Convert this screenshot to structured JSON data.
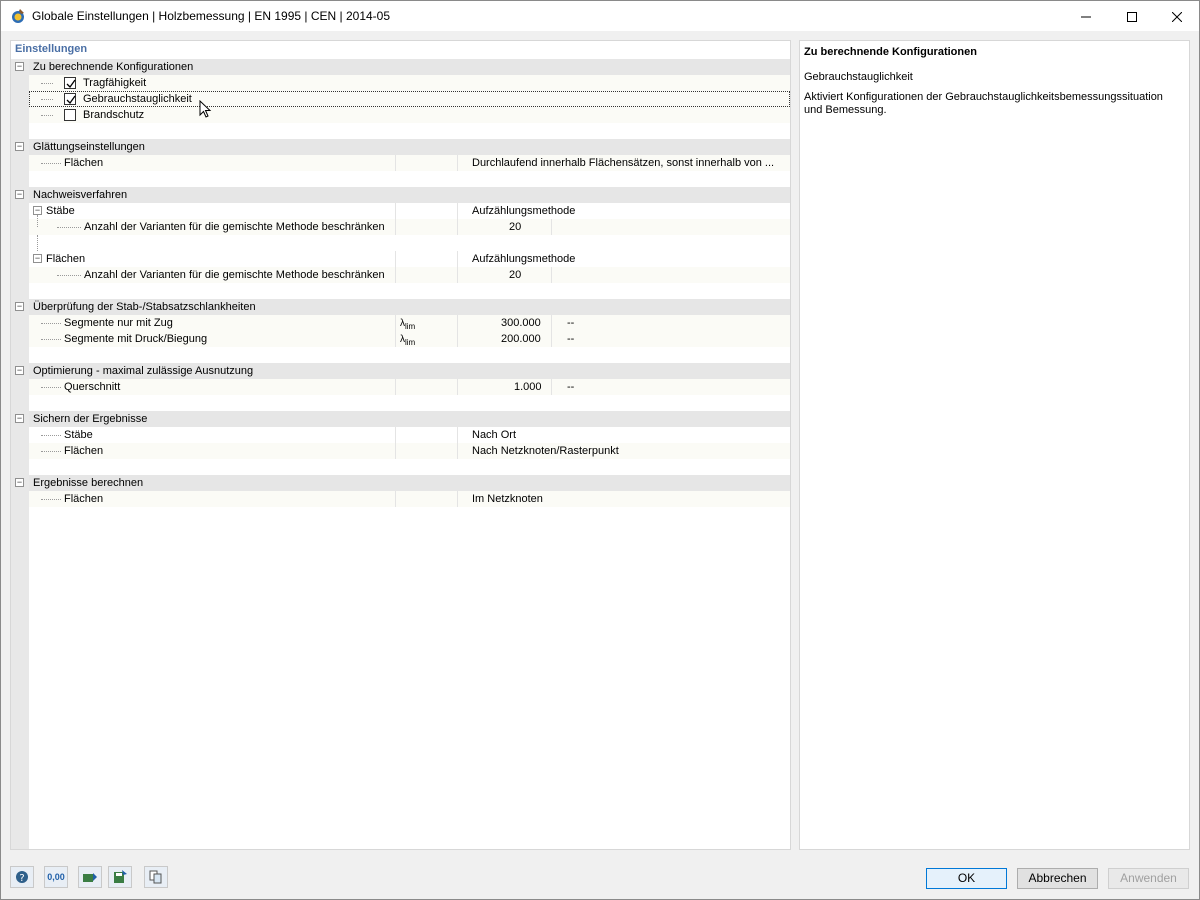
{
  "window": {
    "title": "Globale Einstellungen | Holzbemessung | EN 1995 | CEN | 2014-05"
  },
  "left_panel": {
    "header": "Einstellungen",
    "sections": {
      "konfig": {
        "title": "Zu berechnende Konfigurationen",
        "items": [
          {
            "label": "Tragfähigkeit",
            "checked": true
          },
          {
            "label": "Gebrauchstauglichkeit",
            "checked": true
          },
          {
            "label": "Brandschutz",
            "checked": false
          }
        ]
      },
      "glaettung": {
        "title": "Glättungseinstellungen",
        "flaechen_label": "Flächen",
        "flaechen_value": "Durchlaufend innerhalb Flächensätzen, sonst innerhalb von ..."
      },
      "nachweis": {
        "title": "Nachweisverfahren",
        "staebe_label": "Stäbe",
        "staebe_value": "Aufzählungsmethode",
        "staebe_anzahl_label": "Anzahl der Varianten für die gemischte Methode beschränken",
        "staebe_anzahl_value": "20",
        "flaechen_label": "Flächen",
        "flaechen_value": "Aufzählungsmethode",
        "flaechen_anzahl_label": "Anzahl der Varianten für die gemischte Methode beschränken",
        "flaechen_anzahl_value": "20"
      },
      "schlank": {
        "title": "Überprüfung der Stab-/Stabsatzschlankheiten",
        "zug_label": "Segmente nur mit Zug",
        "zug_symbol": "λlim",
        "zug_value": "300.000",
        "zug_unit": "--",
        "druck_label": "Segmente mit Druck/Biegung",
        "druck_symbol": "λlim",
        "druck_value": "200.000",
        "druck_unit": "--"
      },
      "optim": {
        "title": "Optimierung - maximal zulässige Ausnutzung",
        "qs_label": "Querschnitt",
        "qs_value": "1.000",
        "qs_unit": "--"
      },
      "sichern": {
        "title": "Sichern der Ergebnisse",
        "staebe_label": "Stäbe",
        "staebe_value": "Nach Ort",
        "flaechen_label": "Flächen",
        "flaechen_value": "Nach Netzknoten/Rasterpunkt"
      },
      "berechnen": {
        "title": "Ergebnisse berechnen",
        "flaechen_label": "Flächen",
        "flaechen_value": "Im Netzknoten"
      }
    }
  },
  "right_panel": {
    "title": "Zu berechnende Konfigurationen",
    "subtitle": "Gebrauchstauglichkeit",
    "description": "Aktiviert Konfigurationen der Gebrauchstauglichkeitsbemessungssituation und Bemessung."
  },
  "bottom_icons": {
    "units_label": "0,00"
  },
  "buttons": {
    "ok": "OK",
    "cancel": "Abbrechen",
    "apply": "Anwenden"
  },
  "colors": {
    "header_blue": "#4a6fa5",
    "category_bg": "#e6e6e6",
    "ok_border": "#0078d7"
  }
}
